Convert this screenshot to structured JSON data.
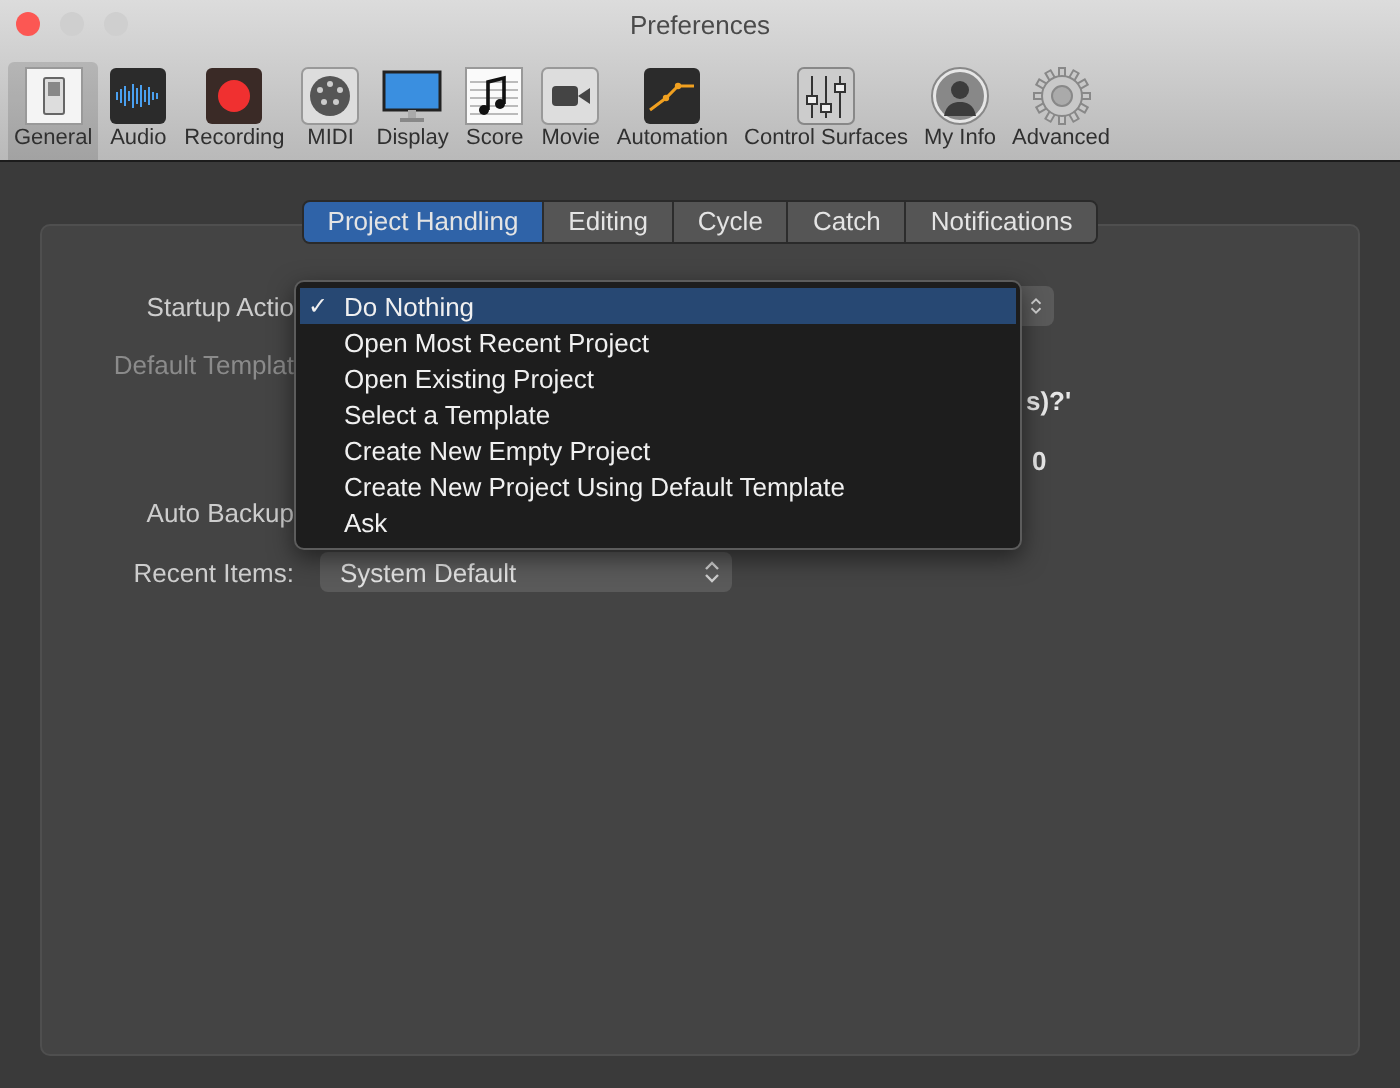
{
  "window": {
    "title": "Preferences"
  },
  "toolbar": [
    {
      "label": "General",
      "kind": "switch",
      "selected": true
    },
    {
      "label": "Audio",
      "kind": "waveform",
      "selected": false
    },
    {
      "label": "Recording",
      "kind": "record",
      "selected": false
    },
    {
      "label": "MIDI",
      "kind": "midi",
      "selected": false
    },
    {
      "label": "Display",
      "kind": "display",
      "selected": false
    },
    {
      "label": "Score",
      "kind": "score",
      "selected": false
    },
    {
      "label": "Movie",
      "kind": "movie",
      "selected": false
    },
    {
      "label": "Automation",
      "kind": "automation",
      "selected": false
    },
    {
      "label": "Control Surfaces",
      "kind": "faders",
      "selected": false
    },
    {
      "label": "My Info",
      "kind": "person",
      "selected": false
    },
    {
      "label": "Advanced",
      "kind": "gear",
      "selected": false
    }
  ],
  "tabs": [
    {
      "label": "Project Handling",
      "selected": true
    },
    {
      "label": "Editing",
      "selected": false
    },
    {
      "label": "Cycle",
      "selected": false
    },
    {
      "label": "Catch",
      "selected": false
    },
    {
      "label": "Notifications",
      "selected": false
    }
  ],
  "form": {
    "startup_label": "Startup Actio",
    "template_label": "Default Templat",
    "template_disabled": true,
    "fragment_1": "s)?'",
    "fragment_2": "0",
    "backup_label": "Auto Backup",
    "recent_label": "Recent Items:",
    "recent_value": "System Default"
  },
  "menu_check": "✓",
  "menu": [
    {
      "label": "Do Nothing",
      "checked": true,
      "selected": true
    },
    {
      "label": "Open Most Recent Project",
      "checked": false,
      "selected": false
    },
    {
      "label": "Open Existing Project",
      "checked": false,
      "selected": false
    },
    {
      "label": "Select a Template",
      "checked": false,
      "selected": false
    },
    {
      "label": "Create New Empty Project",
      "checked": false,
      "selected": false
    },
    {
      "label": "Create New Project Using Default Template",
      "checked": false,
      "selected": false
    },
    {
      "label": "Ask",
      "checked": false,
      "selected": false
    }
  ]
}
